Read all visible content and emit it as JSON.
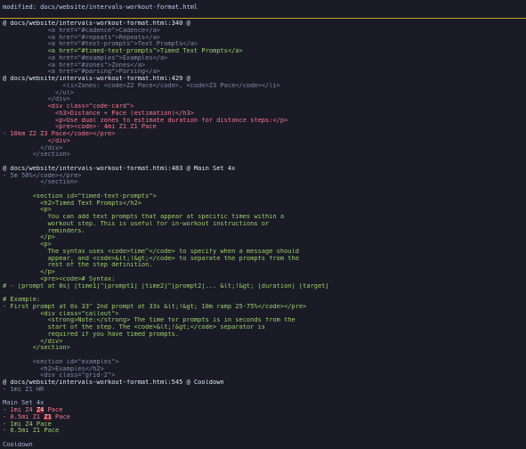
{
  "status": {
    "text": "modified: docs/website/intervals-workout-format.html"
  },
  "lines": [
    {
      "kind": "hunk",
      "text": "@ docs/website/intervals-workout-format.html:340 @"
    },
    {
      "kind": "ctx",
      "text": "            <a href=\"#cadence\">Cadence</a>"
    },
    {
      "kind": "ctx",
      "text": "            <a href=\"#repeats\">Repeats</a>"
    },
    {
      "kind": "ctx",
      "text": "            <a href=\"#text-prompts\">Text Prompts</a>"
    },
    {
      "kind": "add",
      "text": "            <a href=\"#timed-text-prompts\">Timed Text Prompts</a>"
    },
    {
      "kind": "ctx",
      "text": "            <a href=\"#examples\">Examples</a>"
    },
    {
      "kind": "ctx",
      "text": "            <a href=\"#zones\">Zones</a>"
    },
    {
      "kind": "ctx",
      "text": "            <a href=\"#parsing\">Parsing</a>"
    },
    {
      "kind": "hunk",
      "text": "@ docs/website/intervals-workout-format.html:429 @"
    },
    {
      "kind": "ctx",
      "text": "                <li>Zones: <code>Z2 Pace</code>, <code>Z3 Pace</code></li>"
    },
    {
      "kind": "ctx",
      "text": "              </ul>"
    },
    {
      "kind": "ctx",
      "text": "            </div>"
    },
    {
      "kind": "del",
      "text": "            <div class=\"code-card\">"
    },
    {
      "kind": "del",
      "text": "              <h3>Distance + Pace (estimation)</h3>"
    },
    {
      "kind": "del",
      "text": "              <p>Use dual zones to estimate duration for distance steps:</p>"
    },
    {
      "kind": "del",
      "text": "              <pre><code>- 4mi Z1 Z1 Pace"
    },
    {
      "kind": "del",
      "text": "- 10km Z2 Z3 Pace</code></pre>"
    },
    {
      "kind": "del",
      "text": "            </div>"
    },
    {
      "kind": "ctx",
      "text": "          </div>"
    },
    {
      "kind": "ctx",
      "text": "        </section>"
    },
    {
      "kind": "blank",
      "text": ""
    },
    {
      "kind": "hunk",
      "text": "@ docs/website/intervals-workout-format.html:483 @ Main Set 4x"
    },
    {
      "kind": "ctx",
      "text": "- 5m 50%</code></pre>"
    },
    {
      "kind": "ctx",
      "text": "          </section>"
    },
    {
      "kind": "blank",
      "text": ""
    },
    {
      "kind": "add",
      "text": "        <section id=\"timed-text-prompts\">"
    },
    {
      "kind": "add",
      "text": "          <h2>Timed Text Prompts</h2>"
    },
    {
      "kind": "add",
      "text": "          <p>"
    },
    {
      "kind": "add",
      "text": "            You can add text prompts that appear at specific times within a"
    },
    {
      "kind": "add",
      "text": "            workout step. This is useful for in-workout instructions or"
    },
    {
      "kind": "add",
      "text": "            reminders."
    },
    {
      "kind": "add",
      "text": "          </p>"
    },
    {
      "kind": "add",
      "text": "          <p>"
    },
    {
      "kind": "add",
      "text": "            The syntax uses <code>time^</code> to specify when a message should"
    },
    {
      "kind": "add",
      "text": "            appear, and <code>&lt;!&gt;</code> to separate the prompts from the"
    },
    {
      "kind": "add",
      "text": "            rest of the step definition."
    },
    {
      "kind": "add",
      "text": "          </p>"
    },
    {
      "kind": "add",
      "text": "          <pre><code># Syntax:"
    },
    {
      "kind": "add",
      "text": "# - [prompt at 0s] [time1]^[prompt1] [time2]^[prompt2]... &lt;!&gt; [duration] [target]"
    },
    {
      "kind": "blank",
      "text": ""
    },
    {
      "kind": "add",
      "text": "# Example:"
    },
    {
      "kind": "add",
      "text": "- First prompt at 0s 33^ 2nd prompt at 33s &lt;!&gt; 10m ramp 25-75%</code></pre>"
    },
    {
      "kind": "add",
      "text": "          <div class=\"callout\">"
    },
    {
      "kind": "add",
      "text": "            <strong>Note:</strong> The time for prompts is in seconds from the"
    },
    {
      "kind": "add",
      "text": "            start of the step. The <code>&lt;!&gt;</code> separator is"
    },
    {
      "kind": "add",
      "text": "            required if you have timed prompts."
    },
    {
      "kind": "add",
      "text": "          </div>"
    },
    {
      "kind": "add",
      "text": "        </section>"
    },
    {
      "kind": "blank",
      "text": ""
    },
    {
      "kind": "ctx",
      "text": "        <section id=\"examples\">"
    },
    {
      "kind": "ctx",
      "text": "          <h2>Examples</h2>"
    },
    {
      "kind": "ctx",
      "text": "          <div class=\"grid-2\">"
    },
    {
      "kind": "hunk",
      "text": "@ docs/website/intervals-workout-format.html:545 @ Cooldown"
    },
    {
      "kind": "ctx",
      "text": "- 1mi Z1 HR"
    },
    {
      "kind": "blank",
      "text": ""
    },
    {
      "kind": "plain",
      "text": "Main Set 4x"
    },
    {
      "kind": "del",
      "text": "- 1mi Z4 Z4 Pace",
      "mark": "Z4"
    },
    {
      "kind": "del",
      "text": "- 0.5mi Z1 Z1 Pace",
      "mark": "Z1"
    },
    {
      "kind": "add",
      "text": "- 1mi Z4 Pace"
    },
    {
      "kind": "add",
      "text": "- 0.5mi Z1 Pace"
    },
    {
      "kind": "blank",
      "text": ""
    },
    {
      "kind": "plain",
      "text": "Cooldown"
    }
  ]
}
